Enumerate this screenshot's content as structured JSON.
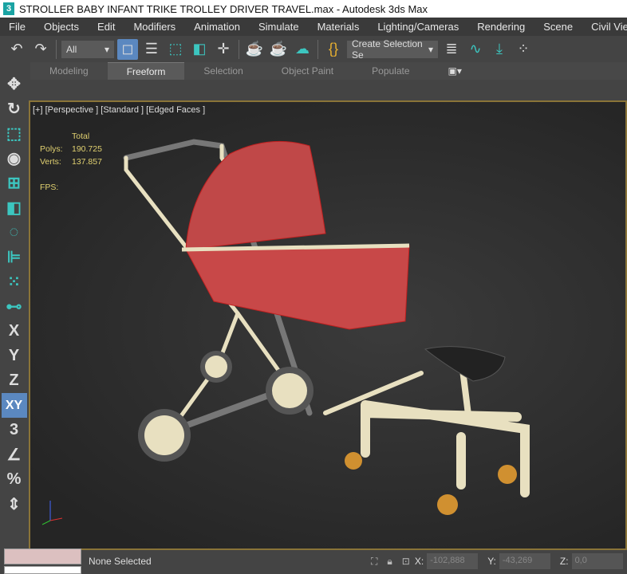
{
  "title": {
    "logo": "3",
    "text": "STROLLER  BABY INFANT TRIKE TROLLEY DRIVER TRAVEL.max - Autodesk 3ds Max"
  },
  "menu": [
    "File",
    "Objects",
    "Edit",
    "Modifiers",
    "Animation",
    "Simulate",
    "Materials",
    "Lighting/Cameras",
    "Rendering",
    "Scene",
    "Civil View"
  ],
  "toolbar": {
    "filter": "All",
    "selection_set": "Create Selection Se"
  },
  "ribbon": {
    "tabs": [
      "Modeling",
      "Freeform",
      "Selection",
      "Object Paint",
      "Populate"
    ],
    "active": "Freeform"
  },
  "left_toolbar": {
    "axis_labels": [
      "X",
      "Y",
      "Z",
      "XY"
    ]
  },
  "viewport": {
    "label": "[+] [Perspective ] [Standard ] [Edged Faces ]",
    "stats_header": "Total",
    "polys_label": "Polys:",
    "polys": "190.725",
    "verts_label": "Verts:",
    "verts": "137.857",
    "fps_label": "FPS:"
  },
  "status": {
    "selection": "None Selected",
    "x_label": "X:",
    "x": "-102,888",
    "y_label": "Y:",
    "y": "-43,269",
    "z_label": "Z:",
    "z": "0,0"
  },
  "colors": {
    "accent": "#5b88c0",
    "viewport_border": "#8a7438",
    "stats": "#e0d070"
  }
}
